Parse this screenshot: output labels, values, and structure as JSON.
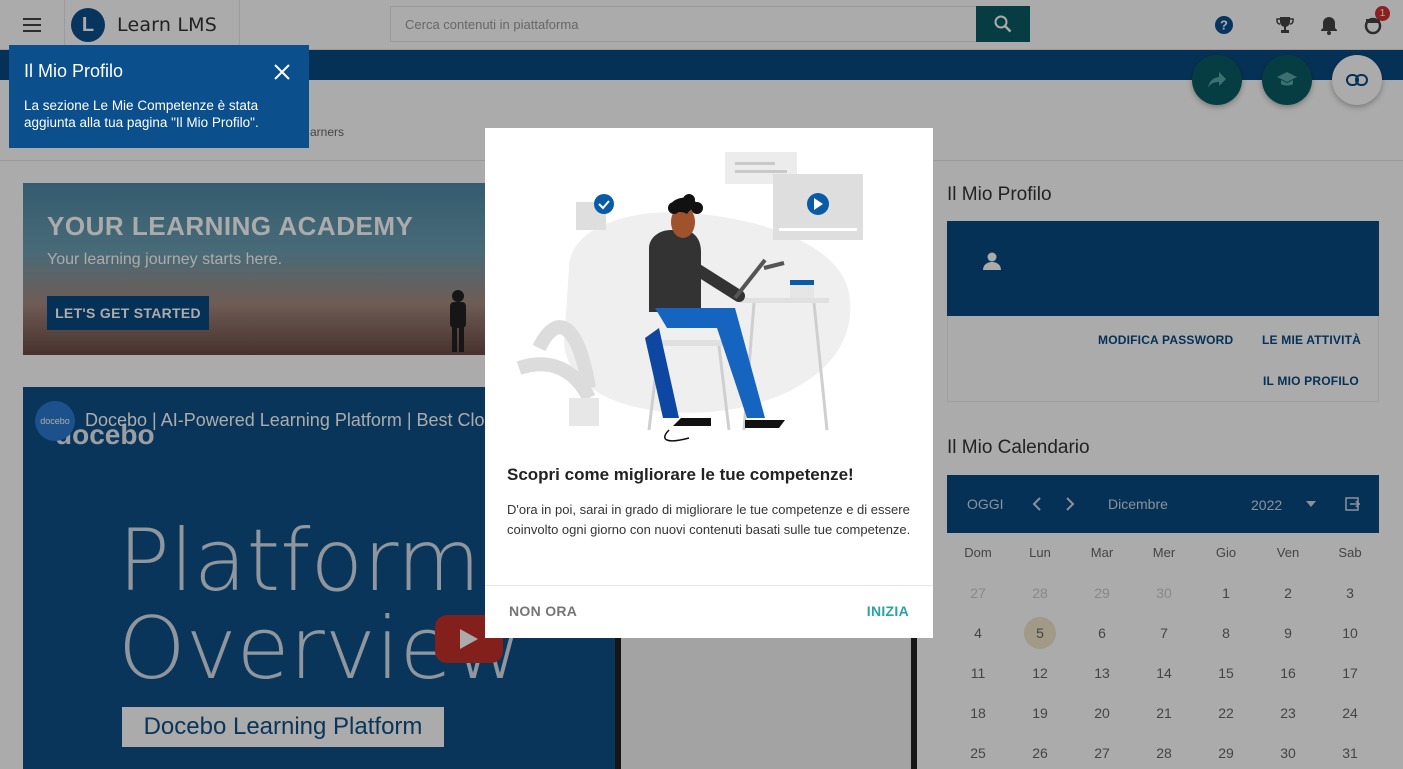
{
  "app": {
    "name": "Learn LMS",
    "logo_letter": "L"
  },
  "search": {
    "placeholder": "Cerca contenuti in piattaforma"
  },
  "notifications": {
    "badge_count": "1"
  },
  "tooltip": {
    "title": "Il Mio Profilo",
    "text": "La sezione Le Mie Competenze è stata aggiunta alla tua pagina \"Il Mio Profilo\"."
  },
  "breadcrumb": {
    "partial": "arners"
  },
  "banner": {
    "title": "YOUR LEARNING ACADEMY",
    "subtitle": "Your learning journey starts here.",
    "button": "LET'S GET STARTED"
  },
  "video": {
    "channel_logo": "docebo",
    "title": "Docebo | AI-Powered Learning Platform | Best Clou",
    "brand": "docebo",
    "big_line1": "Platform",
    "big_line2": "Overview",
    "caption": "Docebo Learning Platform"
  },
  "profile": {
    "section_title": "Il Mio Profilo",
    "links": [
      "MODIFICA PASSWORD",
      "LE MIE ATTIVITÀ",
      "IL MIO PROFILO"
    ]
  },
  "calendar": {
    "section_title": "Il Mio Calendario",
    "today_label": "OGGI",
    "month": "Dicembre",
    "year": "2022",
    "day_names": [
      "Dom",
      "Lun",
      "Mar",
      "Mer",
      "Gio",
      "Ven",
      "Sab"
    ],
    "weeks": [
      [
        "27",
        "28",
        "29",
        "30",
        "1",
        "2",
        "3"
      ],
      [
        "4",
        "5",
        "6",
        "7",
        "8",
        "9",
        "10"
      ],
      [
        "11",
        "12",
        "13",
        "14",
        "15",
        "16",
        "17"
      ],
      [
        "18",
        "19",
        "20",
        "21",
        "22",
        "23",
        "24"
      ],
      [
        "25",
        "26",
        "27",
        "28",
        "29",
        "30",
        "31"
      ]
    ],
    "today": "5"
  },
  "modal": {
    "title": "Scopri come migliorare le tue competenze!",
    "body": "D'ora in poi, sarai in grado di migliorare le tue competenze e di essere coinvolto ogni giorno con nuovi contenuti basati sulle tue competenze.",
    "secondary_button": "NON ORA",
    "primary_button": "INIZIA"
  },
  "colors": {
    "brand": "#0a4a82",
    "search_button": "#0a5c63",
    "accent": "#2aa3a3",
    "badge": "#d0312d"
  }
}
